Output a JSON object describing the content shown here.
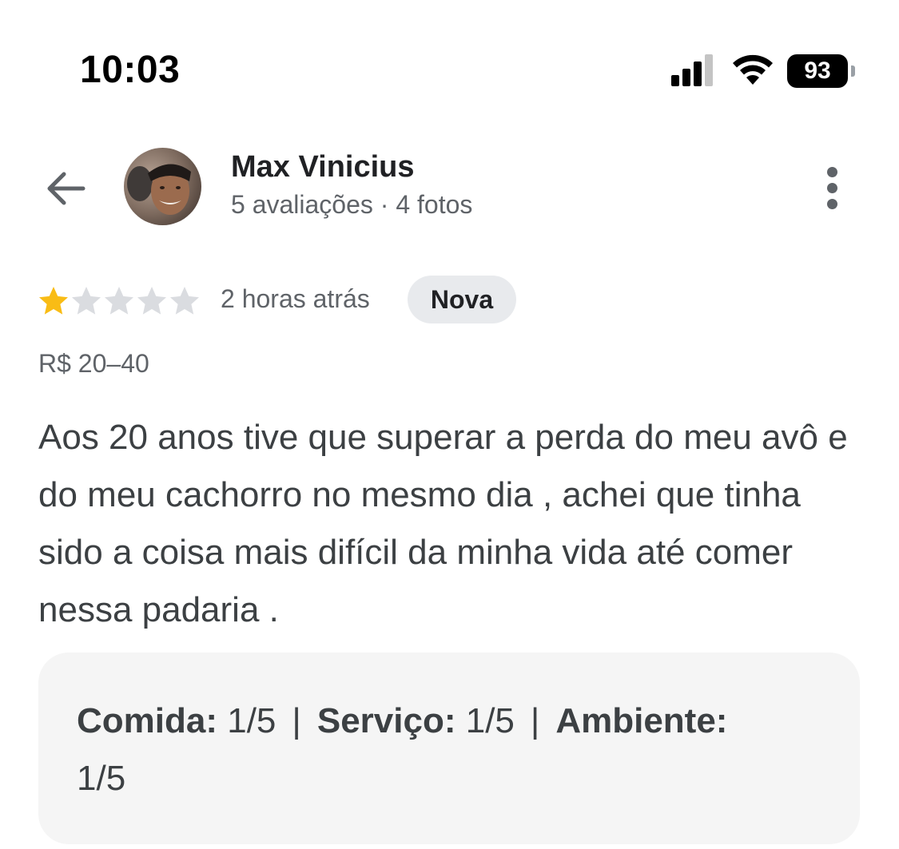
{
  "status_bar": {
    "time": "10:03",
    "battery_level": "93",
    "signal_bars_active": 3,
    "signal_bars_total": 4
  },
  "header": {
    "back_icon": "arrow-back-icon",
    "reviewer_name": "Max Vinicius",
    "reviewer_meta": "5 avaliações · 4 fotos",
    "more_icon": "more-vertical-icon"
  },
  "review": {
    "rating": 1,
    "rating_max": 5,
    "time_ago": "2 horas atrás",
    "badge": "Nova",
    "price_range": "R$ 20–40",
    "text": "Aos 20 anos tive que superar a perda do meu avô e do meu cachorro no mesmo dia , achei que tinha sido a coisa mais difícil da minha vida até comer nessa padaria .",
    "attributes": [
      {
        "label": "Comida:",
        "value": "1/5"
      },
      {
        "label": "Serviço:",
        "value": "1/5"
      },
      {
        "label": "Ambiente:",
        "value": "1/5"
      }
    ],
    "attribute_separator": "|"
  },
  "colors": {
    "star_filled": "#f9bc15",
    "star_empty": "#dadce0",
    "badge_bg": "#e8eaed",
    "attributes_bg": "#f5f5f5"
  }
}
